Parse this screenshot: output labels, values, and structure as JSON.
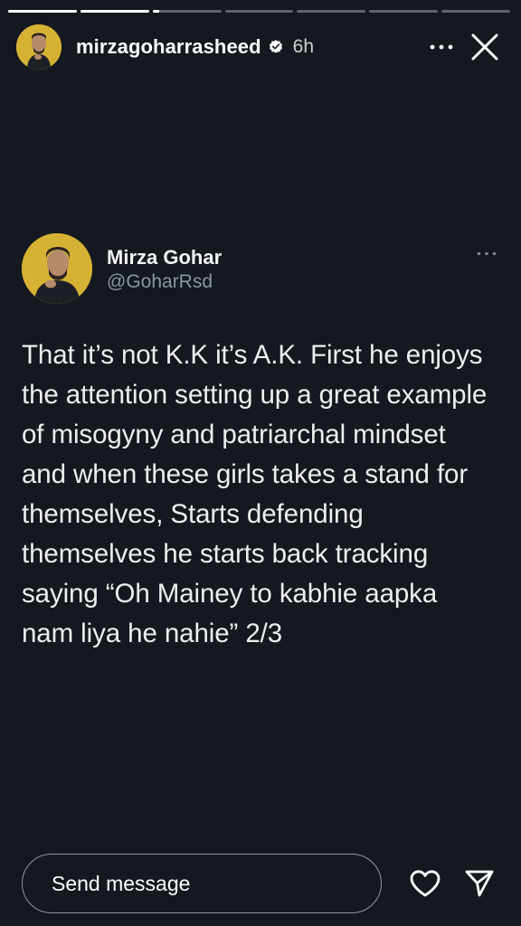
{
  "story": {
    "progress_segments": [
      1,
      1,
      0.1,
      0,
      0,
      0,
      0
    ],
    "header": {
      "username": "mirzagoharrasheed",
      "verified": true,
      "time": "6h",
      "more_icon": "more-horizontal-icon",
      "close_icon": "close-icon"
    }
  },
  "tweet": {
    "display_name": "Mirza Gohar",
    "handle": "@GoharRsd",
    "text": "That it’s not K.K it’s A.K. First he enjoys the attention setting up a great example of misogyny and patriarchal mindset and when these girls takes a stand for themselves, Starts defending themselves he starts back tracking saying “Oh Mainey to kabhie aapka nam liya he nahie” 2/3"
  },
  "footer": {
    "message_placeholder": "Send message",
    "like_icon": "heart-icon",
    "share_icon": "send-icon"
  },
  "colors": {
    "background": "#14181f",
    "avatar_bg": "#d6b234",
    "handle_text": "#8b96a1"
  }
}
